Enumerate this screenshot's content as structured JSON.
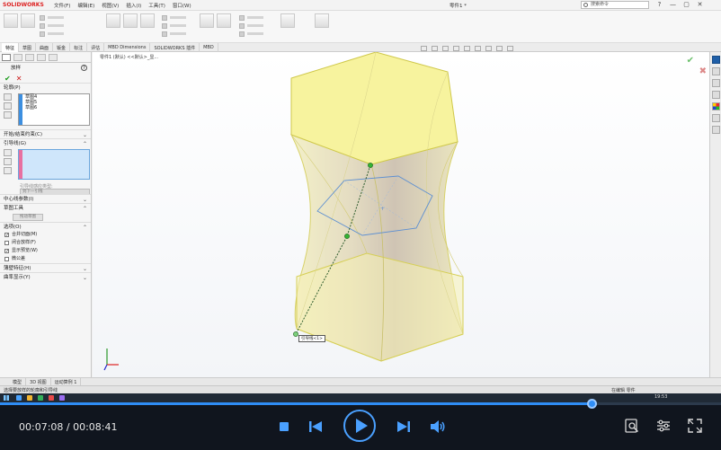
{
  "app": {
    "logo_text": "SOLIDWORKS",
    "menus": [
      "文件(F)",
      "编辑(E)",
      "视图(V)",
      "插入(I)",
      "工具(T)",
      "窗口(W)"
    ],
    "doc_title": "零件1 *",
    "search_placeholder": "搜索命令",
    "window_buttons": [
      "?",
      "—",
      "▢",
      "✕"
    ]
  },
  "tabs": [
    "特征",
    "草图",
    "曲面",
    "钣金",
    "标注",
    "评估",
    "MBD Dimensions",
    "SOLIDWORKS 插件",
    "MBD"
  ],
  "active_tab_index": 0,
  "property_manager": {
    "title": "放样",
    "help_symbol": "?",
    "ok_symbol": "✔",
    "cancel_symbol": "✕",
    "profile_section": "轮廓(P)",
    "profiles": [
      "草图4",
      "草图5",
      "草图6"
    ],
    "start_end_section": "开始/结束约束(C)",
    "guide_section": "引导线(G)",
    "guide_sub_label": "引导线感应类型:",
    "guide_dropdown": "到下一引线",
    "centerline_section": "中心线参数(I)",
    "sketch_tools_section": "草图工具",
    "drag_sketch_button": "拖动草图",
    "options_section": "选项(O)",
    "options": [
      {
        "label": "合并切面(M)",
        "checked": true
      },
      {
        "label": "闭合放样(F)",
        "checked": false
      },
      {
        "label": "显示预览(W)",
        "checked": true
      },
      {
        "label": "微公差",
        "checked": false
      }
    ],
    "thin_feature_section": "薄壁特征(H)",
    "curvature_section": "曲率显示(Y)"
  },
  "viewport": {
    "breadcrumb": "零件1 (默认) <<默认>_显...",
    "tooltip": "引导线<1>",
    "ok_corner": "✔",
    "x_corner": "✖"
  },
  "bottom_tabs": [
    "模型",
    "3D 视图",
    "运动算例 1"
  ],
  "status": {
    "message": "选择要放样的轮廓和引导线",
    "right": "在编辑 零件"
  },
  "taskbar": {
    "tray_text": "19:53"
  },
  "player": {
    "current_time": "00:07:08",
    "total_time": "00:08:41",
    "time_display": "00:07:08 / 00:08:41",
    "progress_fraction": 0.8215,
    "accent_color": "#2f8df5"
  }
}
